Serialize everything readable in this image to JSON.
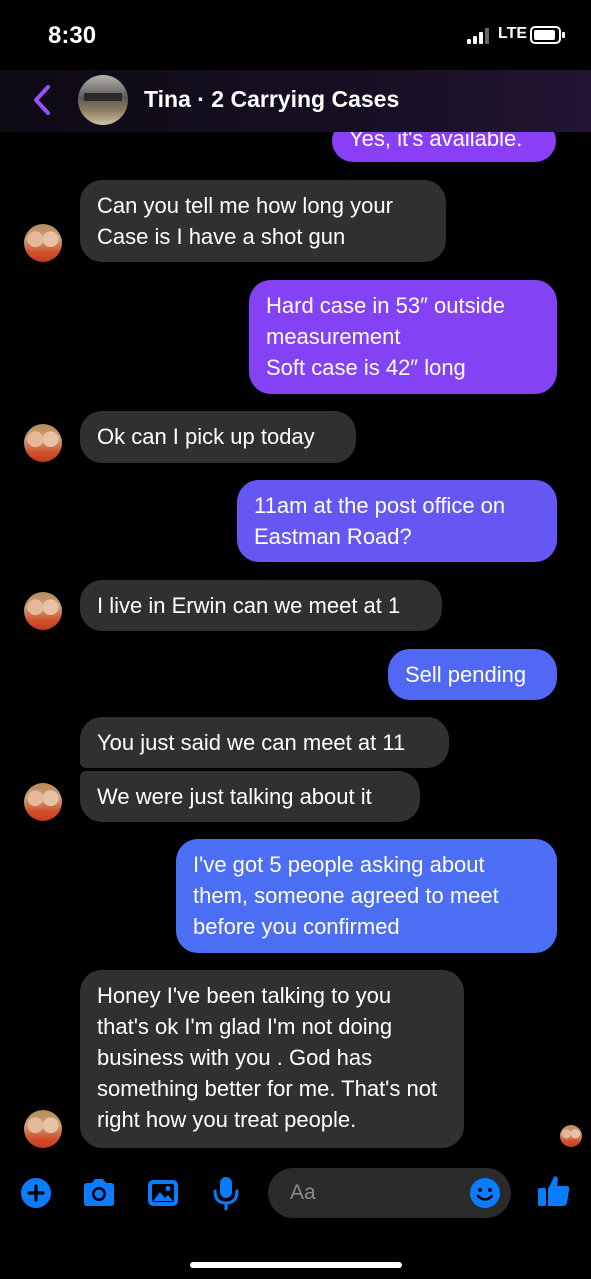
{
  "status_bar": {
    "time": "8:30",
    "network": "LTE"
  },
  "header": {
    "title": "Tina · 2 Carrying Cases"
  },
  "messages": [
    {
      "text": "Yes, it's available."
    },
    {
      "text": "Can you tell me how long your Case is I have a shot gun"
    },
    {
      "text": "Hard case in 53″ outside measurement\nSoft case is 42″ long"
    },
    {
      "text": "Ok can I pick up today"
    },
    {
      "text": "11am at the post office on Eastman Road?"
    },
    {
      "text": "I live in Erwin can we meet at 1"
    },
    {
      "text": "Sell pending"
    },
    {
      "text": "You just said we can meet at 11"
    },
    {
      "text": "We were just talking about it"
    },
    {
      "text": "I've got 5 people asking about them, someone agreed to meet before you confirmed"
    },
    {
      "text": "Honey I've been talking to you that's ok I'm glad I'm not doing business with you . God has something better for me. That's not right how you treat people."
    }
  ],
  "composer": {
    "placeholder": "Aa"
  },
  "icons": {
    "back": "chevron-left-icon",
    "plus": "plus-circle-icon",
    "camera": "camera-icon",
    "gallery": "image-icon",
    "mic": "microphone-icon",
    "emoji": "emoji-icon",
    "like": "thumbs-up-icon"
  },
  "colors": {
    "accent": "#0a7cff",
    "outgoing_purple": "#8343f5",
    "outgoing_blue": "#4b6ef5",
    "incoming": "#303030",
    "header_back": "#9b4dff"
  }
}
